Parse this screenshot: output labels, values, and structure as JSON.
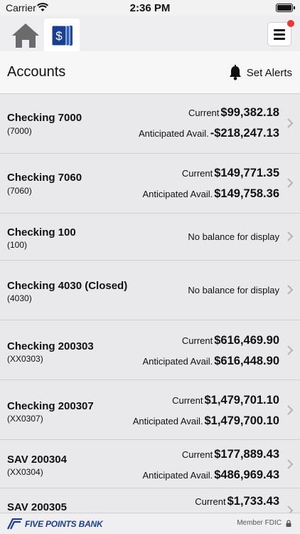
{
  "status_bar": {
    "carrier": "Carrier",
    "time": "2:36 PM"
  },
  "nav": {
    "home_icon": "home-icon",
    "accounts_icon": "dollar-cards-icon",
    "menu_icon": "hamburger-menu-icon"
  },
  "header": {
    "title": "Accounts",
    "alerts_label": "Set Alerts"
  },
  "accounts": [
    {
      "name": "Checking 7000",
      "number": "(7000)",
      "current_label": "Current",
      "current": "$99,382.18",
      "anticipated_label": "Anticipated Avail.",
      "anticipated": "-$218,247.13"
    },
    {
      "name": "Checking 7060",
      "number": "(7060)",
      "current_label": "Current",
      "current": "$149,771.35",
      "anticipated_label": "Anticipated Avail.",
      "anticipated": "$149,758.36"
    },
    {
      "name": "Checking 100",
      "number": "(100)",
      "no_balance": "No balance for display"
    },
    {
      "name": "Checking 4030 (Closed)",
      "number": "(4030)",
      "no_balance": "No balance for display"
    },
    {
      "name": "Checking 200303",
      "number": "(XX0303)",
      "current_label": "Current",
      "current": "$616,469.90",
      "anticipated_label": "Anticipated Avail.",
      "anticipated": "$616,448.90"
    },
    {
      "name": "Checking 200307",
      "number": "(XX0307)",
      "current_label": "Current",
      "current": "$1,479,701.10",
      "anticipated_label": "Anticipated Avail.",
      "anticipated": "$1,479,700.10"
    },
    {
      "name": "SAV 200304",
      "number": "(XX0304)",
      "current_label": "Current",
      "current": "$177,889.43",
      "anticipated_label": "Anticipated Avail.",
      "anticipated": "$486,969.43"
    },
    {
      "name": "SAV 200305",
      "current_label": "Current",
      "current": "$1,733.43"
    }
  ],
  "footer": {
    "bank_name": "FIVE POINTS BANK",
    "member_fdic": "Member FDIC"
  },
  "colors": {
    "brand_blue": "#1a3f8f",
    "notification_red": "#e53935",
    "icon_gray": "#6b6b6b"
  }
}
